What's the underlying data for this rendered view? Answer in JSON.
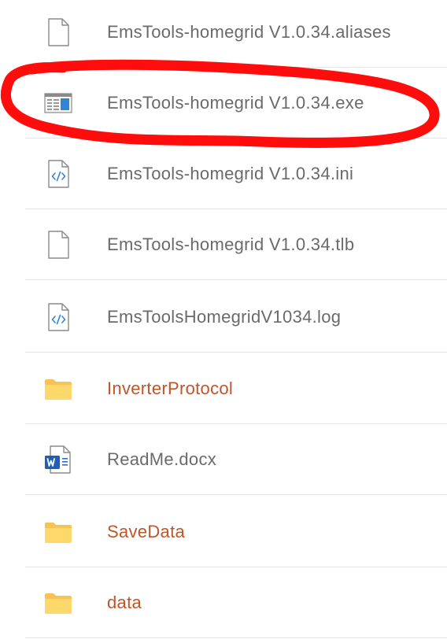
{
  "files": [
    {
      "name": "EmsTools-homegrid V1.0.34.aliases",
      "icon": "document-icon",
      "kind": "file"
    },
    {
      "name": "EmsTools-homegrid V1.0.34.exe",
      "icon": "application-icon",
      "kind": "file",
      "highlighted": true
    },
    {
      "name": "EmsTools-homegrid V1.0.34.ini",
      "icon": "code-file-icon",
      "kind": "file"
    },
    {
      "name": "EmsTools-homegrid V1.0.34.tlb",
      "icon": "document-icon",
      "kind": "file"
    },
    {
      "name": "EmsToolsHomegridV1034.log",
      "icon": "code-file-icon",
      "kind": "file"
    },
    {
      "name": "InverterProtocol",
      "icon": "folder-icon",
      "kind": "folder"
    },
    {
      "name": "ReadMe.docx",
      "icon": "word-document-icon",
      "kind": "file"
    },
    {
      "name": "SaveData",
      "icon": "folder-icon",
      "kind": "folder"
    },
    {
      "name": "data",
      "icon": "folder-icon",
      "kind": "folder"
    }
  ],
  "colors": {
    "file_text": "#6a6a6a",
    "folder_text": "#c0542a",
    "folder_icon": "#fcd34d",
    "highlight_annotation": "#ff0000"
  }
}
